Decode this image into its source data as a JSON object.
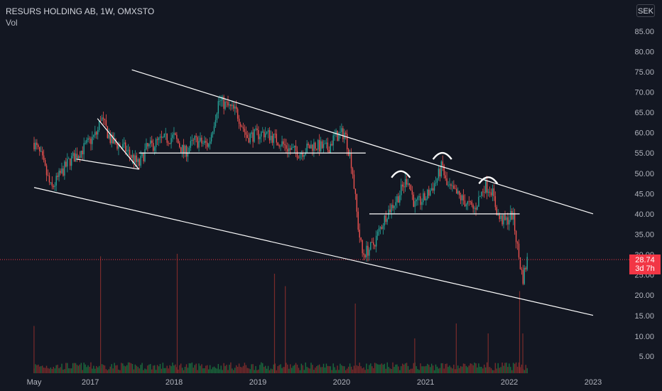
{
  "header": {
    "symbol": "RESURS HOLDING AB",
    "interval": "1W",
    "exchange": "OMXSTO",
    "title": "RESURS HOLDING AB, 1W, OMXSTO",
    "volume_label": "Vol"
  },
  "currency_button": "SEK",
  "last_price": {
    "value": "28.74",
    "countdown": "3d 7h"
  },
  "colors": {
    "background": "#131722",
    "up": "#26a69a",
    "down": "#ef5350",
    "volume_up": "#1b6b3d",
    "volume_down": "#7a2b2b",
    "drawing": "#ffffff",
    "last_price_line": "#f23645"
  },
  "chart_data": {
    "type": "candlestick",
    "series": [
      {
        "name": "RESURS HOLDING AB"
      }
    ],
    "x_axis": {
      "tick_labels": [
        "May",
        "2017",
        "2018",
        "2019",
        "2020",
        "2021",
        "2022",
        "2023"
      ],
      "tick_dates": [
        "2016-05-01",
        "2017-01-01",
        "2018-01-01",
        "2019-01-01",
        "2020-01-01",
        "2021-01-01",
        "2022-01-01",
        "2023-01-01"
      ]
    },
    "y_axis": {
      "position": "right",
      "tick_labels": [
        "5.00",
        "10.00",
        "15.00",
        "20.00",
        "25.00",
        "30.00",
        "35.00",
        "40.00",
        "45.00",
        "50.00",
        "55.00",
        "60.00",
        "65.00",
        "70.00",
        "75.00",
        "80.00",
        "85.00"
      ],
      "range": [
        5,
        85
      ]
    },
    "price_path": [
      [
        "2016-05-01",
        57.5
      ],
      [
        "2016-06-01",
        54
      ],
      [
        "2016-07-15",
        46
      ],
      [
        "2016-08-15",
        49
      ],
      [
        "2016-10-01",
        53
      ],
      [
        "2016-12-01",
        56
      ],
      [
        "2017-02-01",
        60
      ],
      [
        "2017-02-15",
        64
      ],
      [
        "2017-04-01",
        58
      ],
      [
        "2017-06-01",
        56
      ],
      [
        "2017-08-01",
        52
      ],
      [
        "2017-09-01",
        56
      ],
      [
        "2017-11-01",
        58
      ],
      [
        "2018-01-01",
        59
      ],
      [
        "2018-02-15",
        55
      ],
      [
        "2018-04-01",
        58
      ],
      [
        "2018-06-01",
        57
      ],
      [
        "2018-07-15",
        68
      ],
      [
        "2018-10-01",
        65
      ],
      [
        "2018-11-15",
        59
      ],
      [
        "2019-02-01",
        60
      ],
      [
        "2019-04-01",
        58
      ],
      [
        "2019-05-15",
        56
      ],
      [
        "2019-07-01",
        55
      ],
      [
        "2019-09-01",
        57
      ],
      [
        "2019-11-01",
        56
      ],
      [
        "2019-12-01",
        59
      ],
      [
        "2020-01-15",
        60
      ],
      [
        "2020-02-15",
        52
      ],
      [
        "2020-03-15",
        36
      ],
      [
        "2020-04-01",
        30
      ],
      [
        "2020-05-15",
        32
      ],
      [
        "2020-07-15",
        40
      ],
      [
        "2020-09-01",
        44
      ],
      [
        "2020-10-15",
        49
      ],
      [
        "2020-11-15",
        42
      ],
      [
        "2021-01-01",
        44
      ],
      [
        "2021-02-15",
        48
      ],
      [
        "2021-03-15",
        52
      ],
      [
        "2021-04-01",
        47
      ],
      [
        "2021-06-01",
        44
      ],
      [
        "2021-08-01",
        41
      ],
      [
        "2021-09-15",
        47
      ],
      [
        "2021-10-15",
        46
      ],
      [
        "2021-11-15",
        39
      ],
      [
        "2021-12-15",
        38
      ],
      [
        "2022-01-15",
        40
      ],
      [
        "2022-02-15",
        28
      ],
      [
        "2022-03-01",
        24
      ],
      [
        "2022-03-20",
        28.74
      ]
    ],
    "volume_spikes": [
      [
        "2016-05-01",
        9.5
      ],
      [
        "2017-02-15",
        23.5
      ],
      [
        "2018-01-15",
        24
      ],
      [
        "2019-03-15",
        20
      ],
      [
        "2019-05-01",
        17.5
      ],
      [
        "2020-03-01",
        14
      ],
      [
        "2020-11-15",
        7
      ],
      [
        "2021-05-15",
        10
      ],
      [
        "2021-10-01",
        8
      ],
      [
        "2022-02-15",
        16.5
      ],
      [
        "2022-03-01",
        8
      ]
    ],
    "last_price": 28.74,
    "drawings": {
      "trendlines": [
        {
          "from": [
            "2017-07-01",
            75.5
          ],
          "to": [
            "2023-01-01",
            40
          ]
        },
        {
          "from": [
            "2016-05-01",
            46.5
          ],
          "to": [
            "2023-01-01",
            15
          ]
        },
        {
          "from": [
            "2017-02-01",
            63.5
          ],
          "to": [
            "2017-08-01",
            51
          ]
        },
        {
          "from": [
            "2016-11-01",
            53.5
          ],
          "to": [
            "2017-08-01",
            51
          ]
        }
      ],
      "horizontal_segments": [
        {
          "from": "2017-08-01",
          "to": "2020-04-15",
          "y": 55
        },
        {
          "from": "2020-05-01",
          "to": "2022-02-15",
          "y": 40
        }
      ],
      "arcs": [
        {
          "x": "2020-09-15",
          "y": 50
        },
        {
          "x": "2021-03-15",
          "y": 54.5
        },
        {
          "x": "2021-10-01",
          "y": 48.5
        }
      ]
    }
  }
}
